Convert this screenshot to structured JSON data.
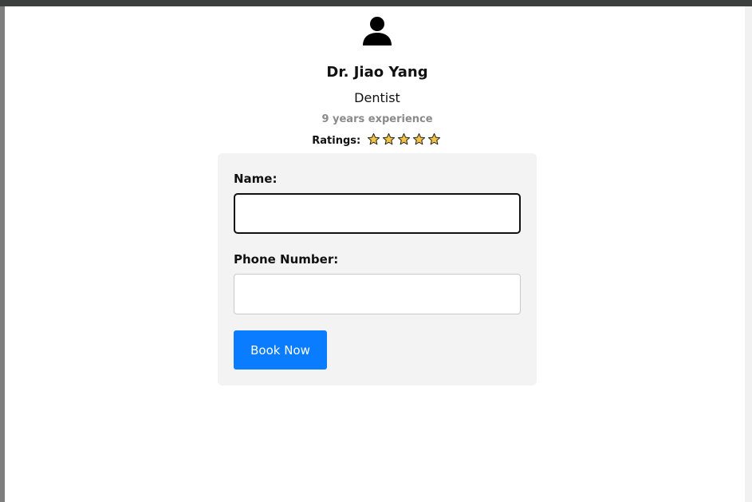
{
  "doctor": {
    "name": "Dr. Jiao Yang",
    "specialty": "Dentist",
    "experience": "9 years experience",
    "ratings_label": "Ratings:",
    "rating_stars": 5,
    "avatar_icon": "user-icon"
  },
  "form": {
    "name_label": "Name:",
    "name_value": "",
    "phone_label": "Phone Number:",
    "phone_value": "",
    "submit_label": "Book Now"
  },
  "colors": {
    "button": "#0a7cff",
    "card": "#f3f3f3",
    "star_fill": "#f4c242",
    "experience_text": "#8a8a8a"
  }
}
